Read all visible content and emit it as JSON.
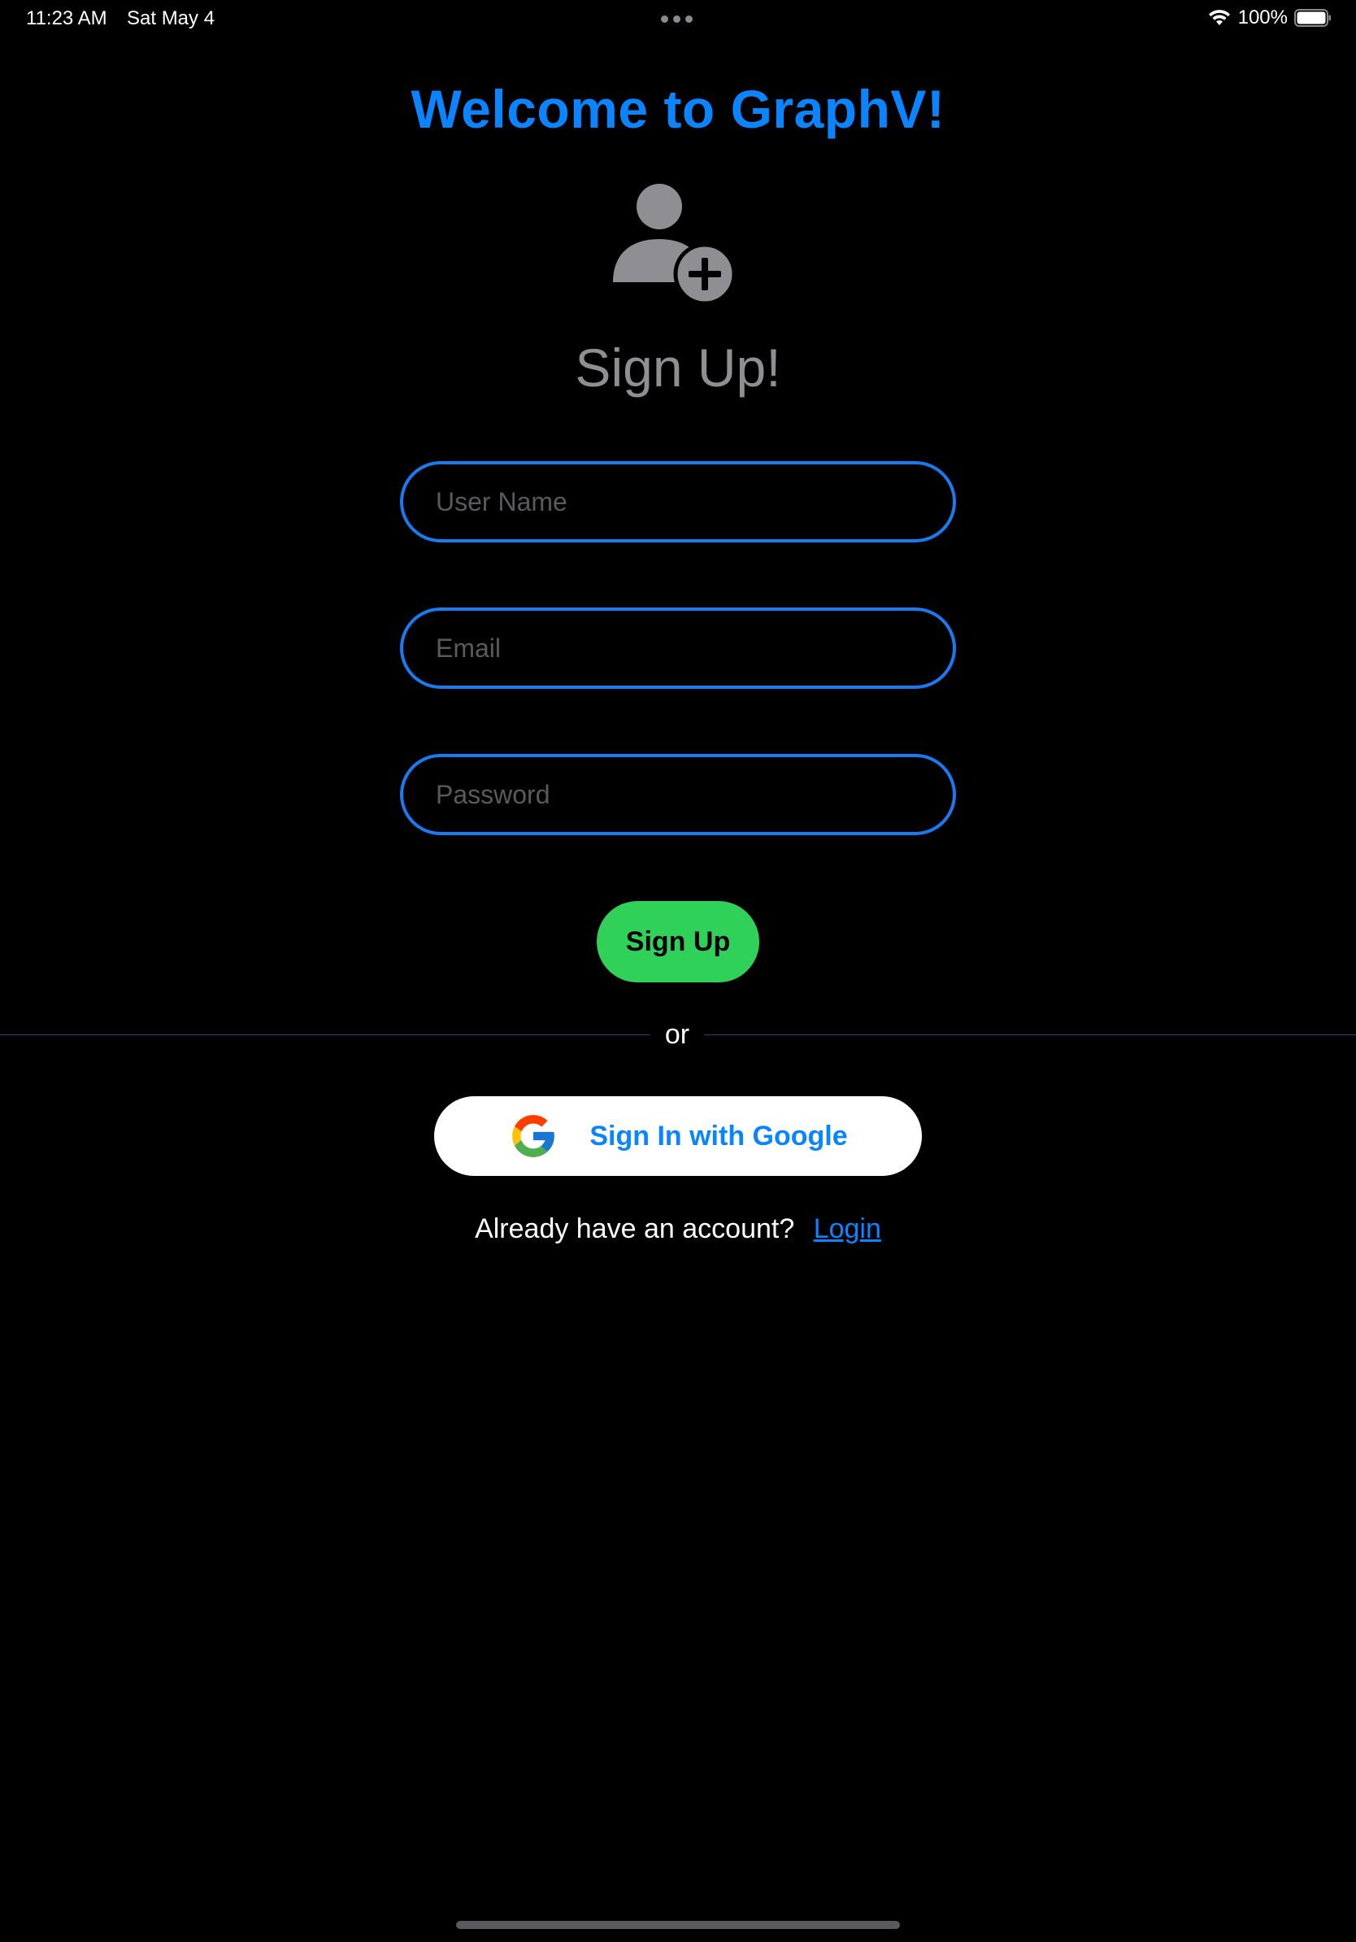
{
  "status_bar": {
    "time": "11:23 AM",
    "date": "Sat May 4",
    "battery_percent": "100%",
    "battery_level": 1.0,
    "icons": [
      "wifi-icon",
      "battery-icon",
      "multitasking-dots-icon"
    ]
  },
  "header": {
    "title": "Welcome to GraphV!",
    "title_color": "#0a84ff",
    "icon": "person-add-icon",
    "subtitle": "Sign Up!"
  },
  "form": {
    "username_placeholder": "User Name",
    "username_value": "",
    "email_placeholder": "Email",
    "email_value": "",
    "password_placeholder": "Password",
    "password_value": "",
    "field_border_color": "#1a7af0",
    "signup_label": "Sign Up",
    "signup_color": "#30d158"
  },
  "divider": {
    "label": "or"
  },
  "google": {
    "label": "Sign In with Google",
    "icon": "google-logo-icon"
  },
  "footer": {
    "prompt": "Already have an account?",
    "login_label": "Login"
  }
}
